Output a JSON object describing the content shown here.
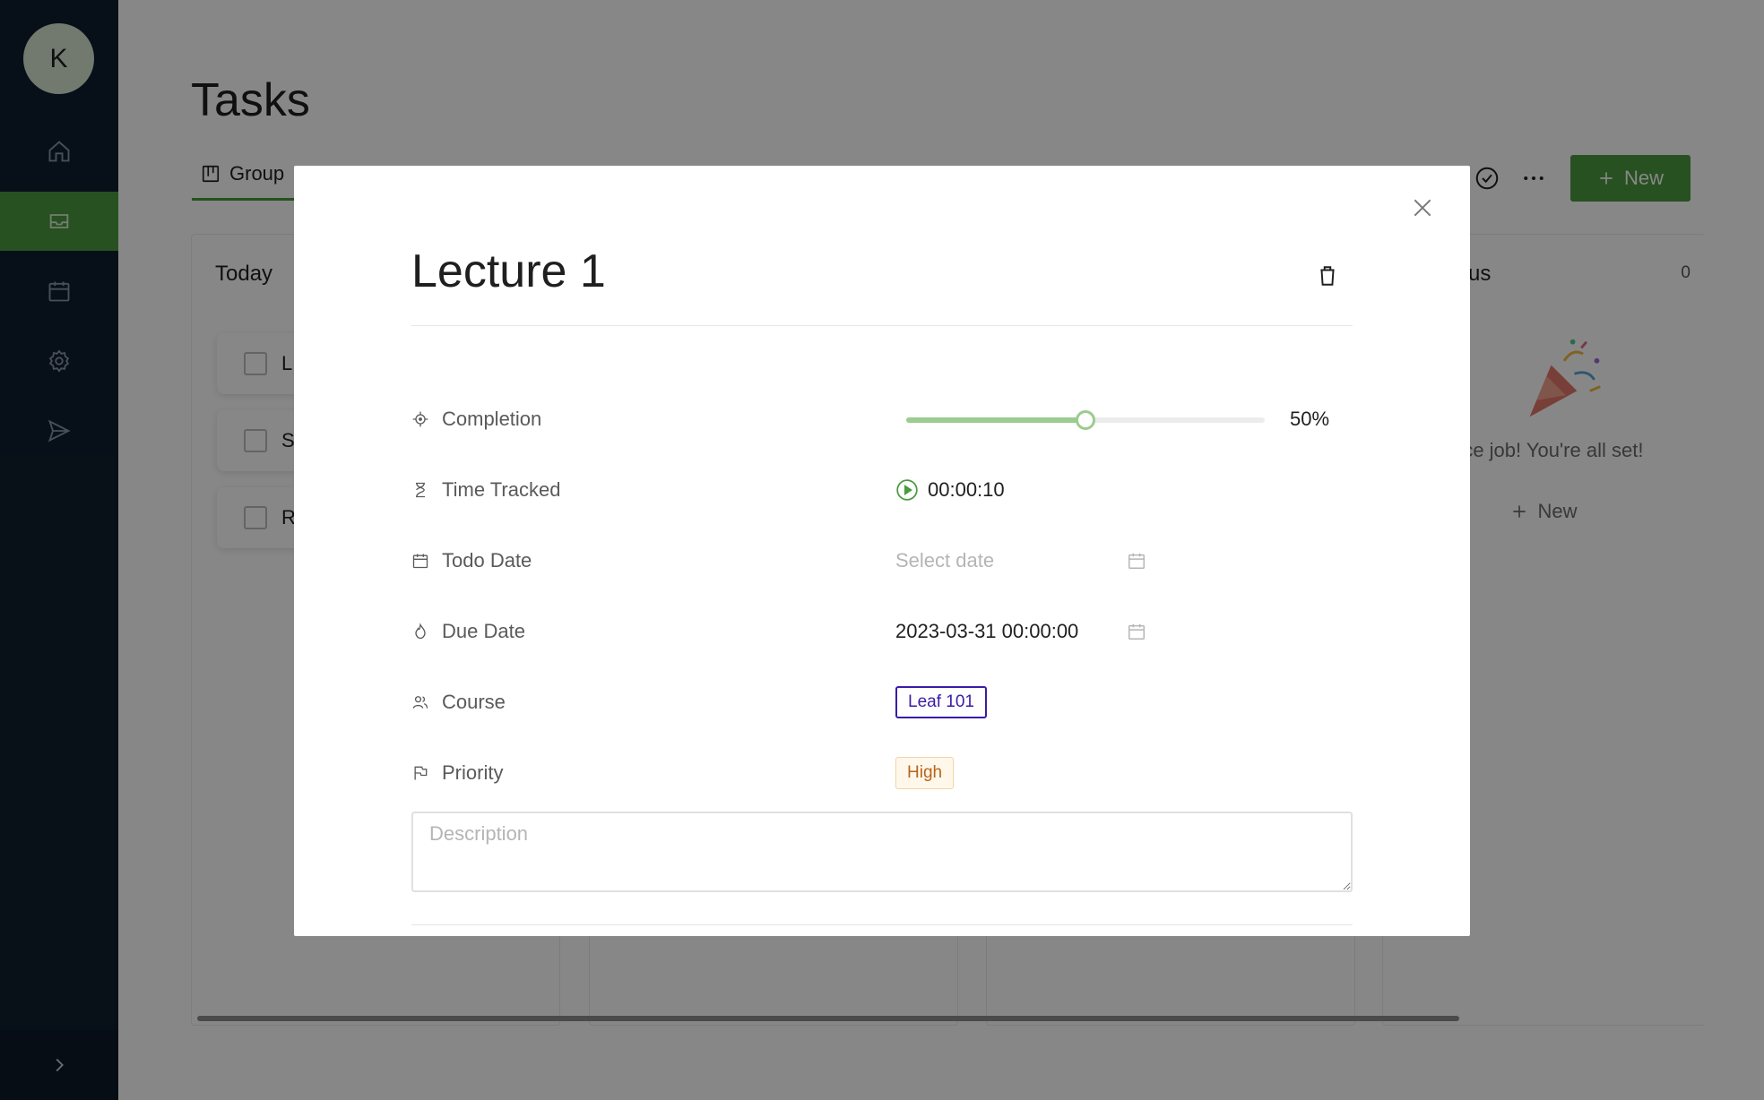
{
  "sidebar": {
    "avatar_initial": "K",
    "items": [
      {
        "name": "home",
        "icon": "home-icon"
      },
      {
        "name": "inbox",
        "icon": "inbox-icon",
        "active": true
      },
      {
        "name": "calendar",
        "icon": "calendar-icon"
      },
      {
        "name": "settings",
        "icon": "gear-icon"
      },
      {
        "name": "send",
        "icon": "send-icon"
      }
    ],
    "expand_icon": "chevron-right-icon"
  },
  "page": {
    "title": "Tasks",
    "tab_label": "Group",
    "new_button_label": "New"
  },
  "board": {
    "columns": [
      {
        "title": "Today",
        "tasks": [
          {
            "label": "L"
          },
          {
            "label": "S"
          },
          {
            "label": "R"
          }
        ]
      },
      {
        "title": ""
      },
      {
        "title": ""
      },
      {
        "title": "atus",
        "count": "0",
        "empty_text": "Nice job! You're all set!",
        "new_label": "New"
      }
    ]
  },
  "modal": {
    "title": "Lecture 1",
    "properties": {
      "completion": {
        "label": "Completion",
        "value_percent": 50,
        "display": "50%"
      },
      "time_tracked": {
        "label": "Time Tracked",
        "value": "00:00:10"
      },
      "todo_date": {
        "label": "Todo Date",
        "placeholder": "Select date"
      },
      "due_date": {
        "label": "Due Date",
        "value": "2023-03-31 00:00:00"
      },
      "course": {
        "label": "Course",
        "value": "Leaf 101"
      },
      "priority": {
        "label": "Priority",
        "value": "High"
      }
    },
    "description_placeholder": "Description"
  },
  "colors": {
    "accent": "#4a9a3e",
    "sidebar_bg": "#0f1f2e",
    "course_tag": "#3a1ca6",
    "priority_tag": "#b8641a"
  }
}
